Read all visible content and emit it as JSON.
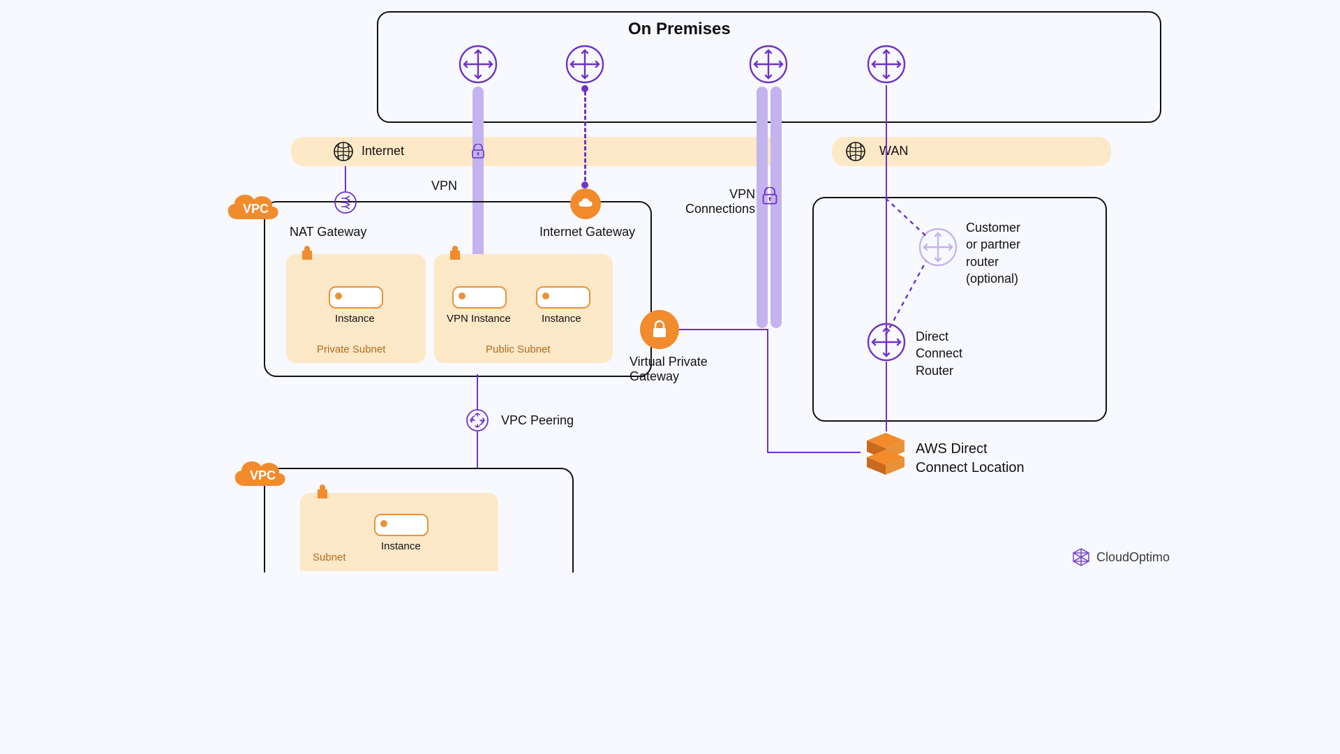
{
  "title": "On Premises",
  "bands": {
    "internet": "Internet",
    "wan": "WAN"
  },
  "labels": {
    "vpn": "VPN",
    "nat": "NAT Gateway",
    "igw": "Internet Gateway",
    "vpnConn": "VPN\nConnections",
    "vpg": "Virtual Private\nGateway",
    "vpcPeer": "VPC Peering",
    "custRouter": "Customer\nor partner\nrouter\n(optional)",
    "dcRouter": "Direct\nConnect\nRouter",
    "dcLoc": "AWS Direct\nConnect Location"
  },
  "vpc1": {
    "badge": "VPC",
    "private": {
      "name": "Private Subnet",
      "instance": "Instance"
    },
    "public": {
      "name": "Public Subnet",
      "vpnInstance": "VPN Instance",
      "instance": "Instance"
    }
  },
  "vpc2": {
    "badge": "VPC",
    "subnet": {
      "name": "Subnet",
      "instance": "Instance"
    }
  },
  "brand": "CloudOptimo"
}
